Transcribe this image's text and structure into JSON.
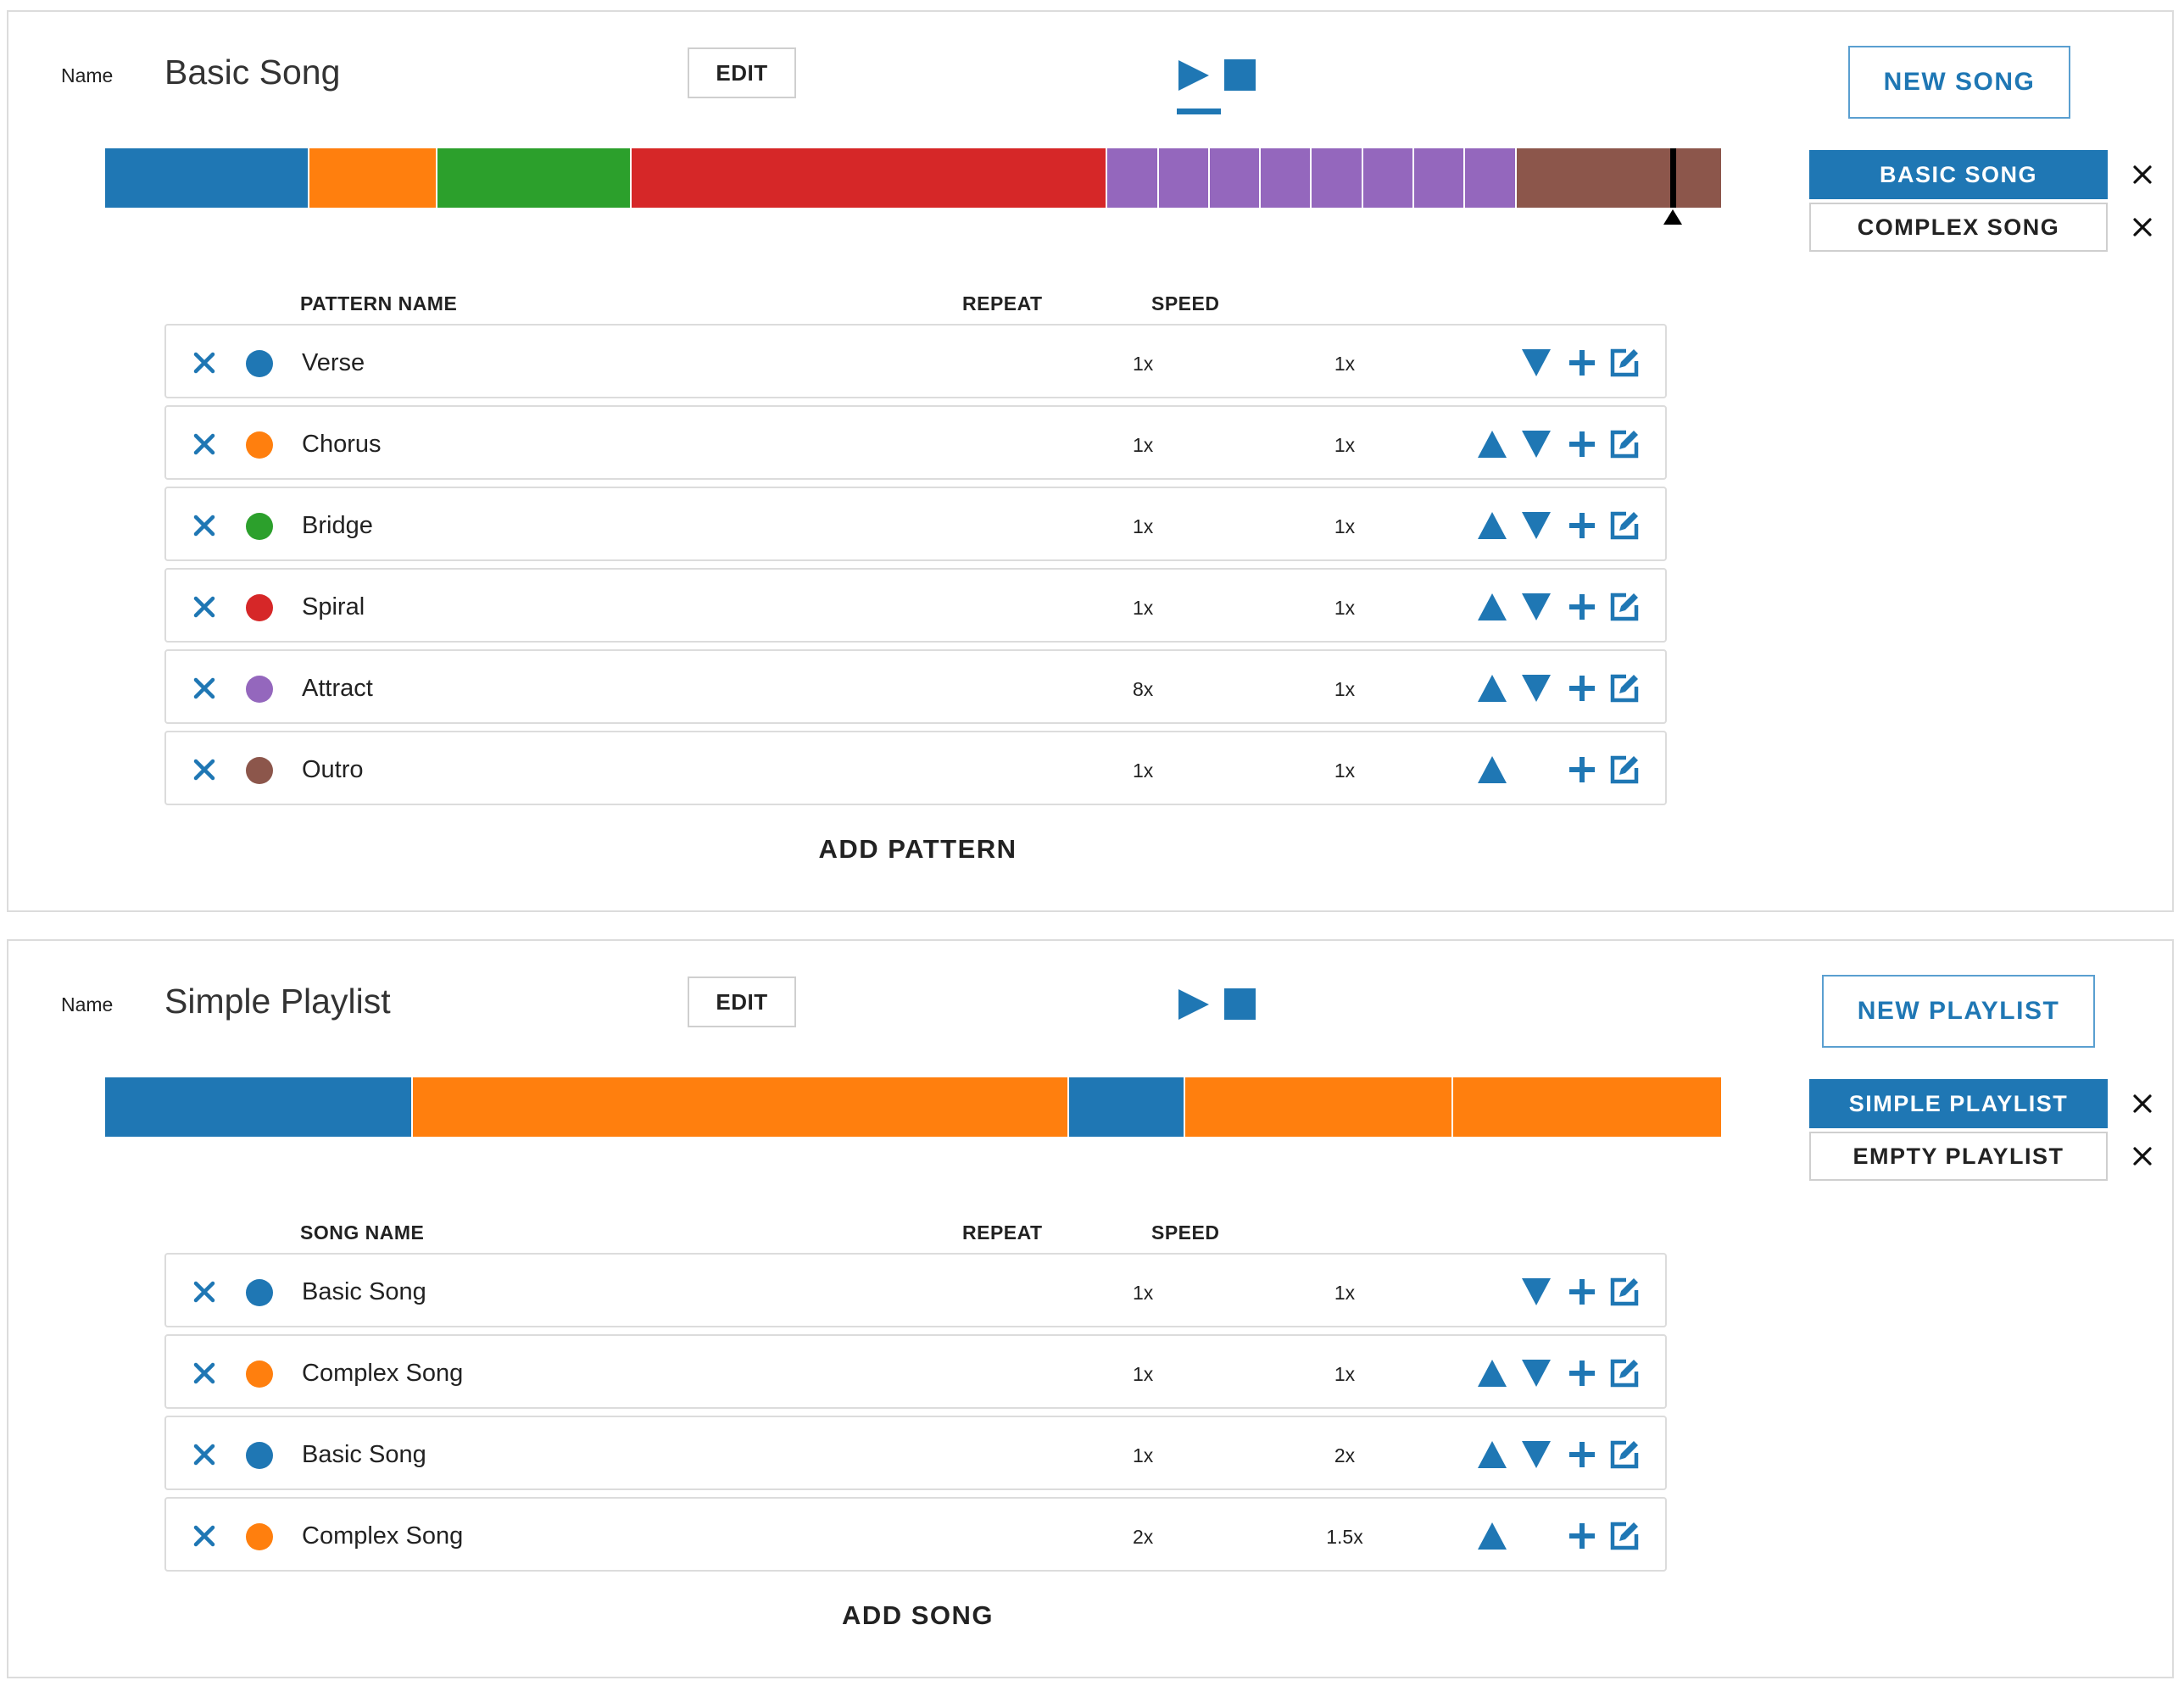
{
  "song_panel": {
    "name_label": "Name",
    "name_value": "Basic Song",
    "edit_label": "EDIT",
    "new_label": "NEW SONG",
    "timeline": [
      {
        "label": "Verse",
        "color": "#1f77b4",
        "units": 4
      },
      {
        "label": "Chorus",
        "color": "#ff7f0e",
        "units": 2.5
      },
      {
        "label": "Bridge",
        "color": "#2ca02c",
        "units": 3.8
      },
      {
        "label": "Spiral",
        "color": "#d62728",
        "units": 9.3
      },
      {
        "label": "Attract",
        "color": "#9467bd",
        "units": 1
      },
      {
        "label": "Attract",
        "color": "#9467bd",
        "units": 1
      },
      {
        "label": "Attract",
        "color": "#9467bd",
        "units": 1
      },
      {
        "label": "Attract",
        "color": "#9467bd",
        "units": 1
      },
      {
        "label": "Attract",
        "color": "#9467bd",
        "units": 1
      },
      {
        "label": "Attract",
        "color": "#9467bd",
        "units": 1
      },
      {
        "label": "Attract",
        "color": "#9467bd",
        "units": 1
      },
      {
        "label": "Attract",
        "color": "#9467bd",
        "units": 1
      },
      {
        "label": "Outro",
        "color": "#8c564b",
        "units": 4
      }
    ],
    "playhead_fraction": 0.97,
    "list": [
      {
        "label": "BASIC SONG",
        "active": true
      },
      {
        "label": "COMPLEX SONG",
        "active": false
      }
    ],
    "headers": {
      "name": "PATTERN NAME",
      "repeat": "REPEAT",
      "speed": "SPEED"
    },
    "rows": [
      {
        "name": "Verse",
        "color": "#1f77b4",
        "repeat": "1x",
        "speed": "1x"
      },
      {
        "name": "Chorus",
        "color": "#ff7f0e",
        "repeat": "1x",
        "speed": "1x"
      },
      {
        "name": "Bridge",
        "color": "#2ca02c",
        "repeat": "1x",
        "speed": "1x"
      },
      {
        "name": "Spiral",
        "color": "#d62728",
        "repeat": "1x",
        "speed": "1x"
      },
      {
        "name": "Attract",
        "color": "#9467bd",
        "repeat": "8x",
        "speed": "1x"
      },
      {
        "name": "Outro",
        "color": "#8c564b",
        "repeat": "1x",
        "speed": "1x"
      }
    ],
    "add_label": "ADD PATTERN"
  },
  "playlist_panel": {
    "name_label": "Name",
    "name_value": "Simple Playlist",
    "edit_label": "EDIT",
    "new_label": "NEW PLAYLIST",
    "timeline": [
      {
        "label": "Basic Song",
        "color": "#1f77b4",
        "units": 2.3
      },
      {
        "label": "Complex Song",
        "color": "#ff7f0e",
        "units": 4.9
      },
      {
        "label": "Basic Song",
        "color": "#1f77b4",
        "units": 0.87
      },
      {
        "label": "Complex Song",
        "color": "#ff7f0e",
        "units": 2.0
      },
      {
        "label": "Complex Song",
        "color": "#ff7f0e",
        "units": 2.0
      }
    ],
    "list": [
      {
        "label": "SIMPLE PLAYLIST",
        "active": true
      },
      {
        "label": "EMPTY PLAYLIST",
        "active": false
      }
    ],
    "headers": {
      "name": "SONG NAME",
      "repeat": "REPEAT",
      "speed": "SPEED"
    },
    "rows": [
      {
        "name": "Basic Song",
        "color": "#1f77b4",
        "repeat": "1x",
        "speed": "1x"
      },
      {
        "name": "Complex Song",
        "color": "#ff7f0e",
        "repeat": "1x",
        "speed": "1x"
      },
      {
        "name": "Basic Song",
        "color": "#1f77b4",
        "repeat": "1x",
        "speed": "2x"
      },
      {
        "name": "Complex Song",
        "color": "#ff7f0e",
        "repeat": "2x",
        "speed": "1.5x"
      }
    ],
    "add_label": "ADD SONG"
  },
  "theme": {
    "accent": "#1f77b4",
    "close_color": "#111111"
  },
  "icons": {
    "play": "play-icon",
    "stop": "stop-icon",
    "delete": "delete-x-icon",
    "up": "move-up-triangle-icon",
    "down": "move-down-triangle-icon",
    "plus": "plus-icon",
    "edit": "edit-pencil-icon",
    "close": "close-icon"
  }
}
